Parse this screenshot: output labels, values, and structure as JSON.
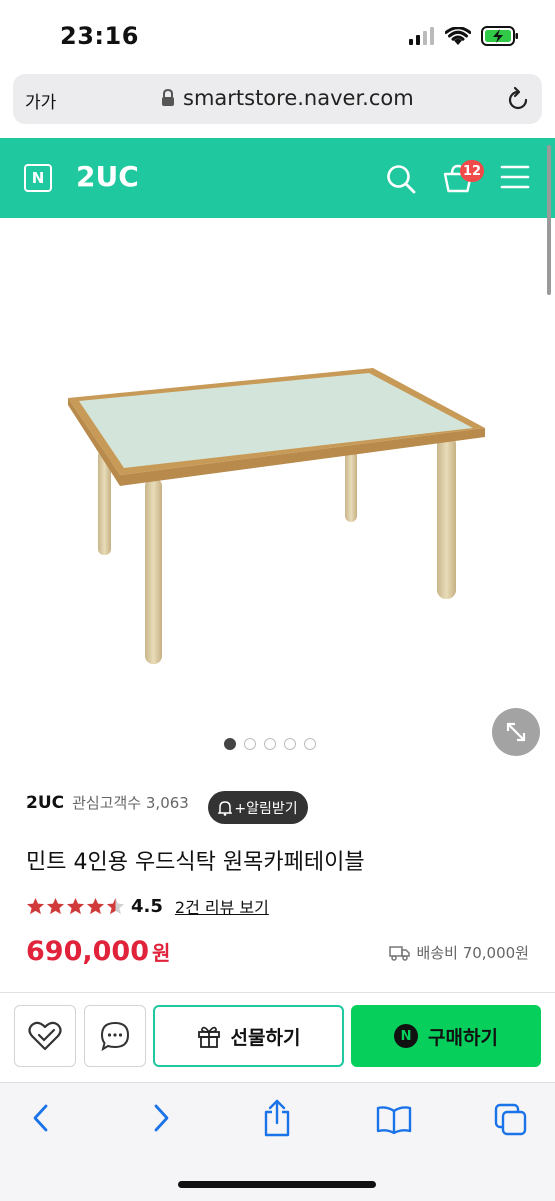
{
  "status_bar": {
    "time": "23:16"
  },
  "browser": {
    "aa_label": "가가",
    "url": "smartstore.naver.com"
  },
  "store_header": {
    "logo_letter": "N",
    "store_name": "2UC",
    "cart_count": "12",
    "accent": "#1fc89e"
  },
  "gallery": {
    "slide_count": 5,
    "active_index": 0
  },
  "seller": {
    "name": "2UC",
    "followers_label": "관심고객수 3,063",
    "alarm_label": "+알림받기"
  },
  "product": {
    "title": "민트 4인용 우드식탁 원목카페테이블",
    "rating": "4.5",
    "rating_stars_filled": 4.5,
    "review_link": "2건 리뷰 보기",
    "price": "690,000",
    "price_unit": "원",
    "shipping": "배송비 70,000원",
    "price_color": "#e0223b"
  },
  "actions": {
    "gift_label": "선물하기",
    "buy_label": "구매하기",
    "buy_logo": "N",
    "buy_color": "#06cf5c"
  }
}
